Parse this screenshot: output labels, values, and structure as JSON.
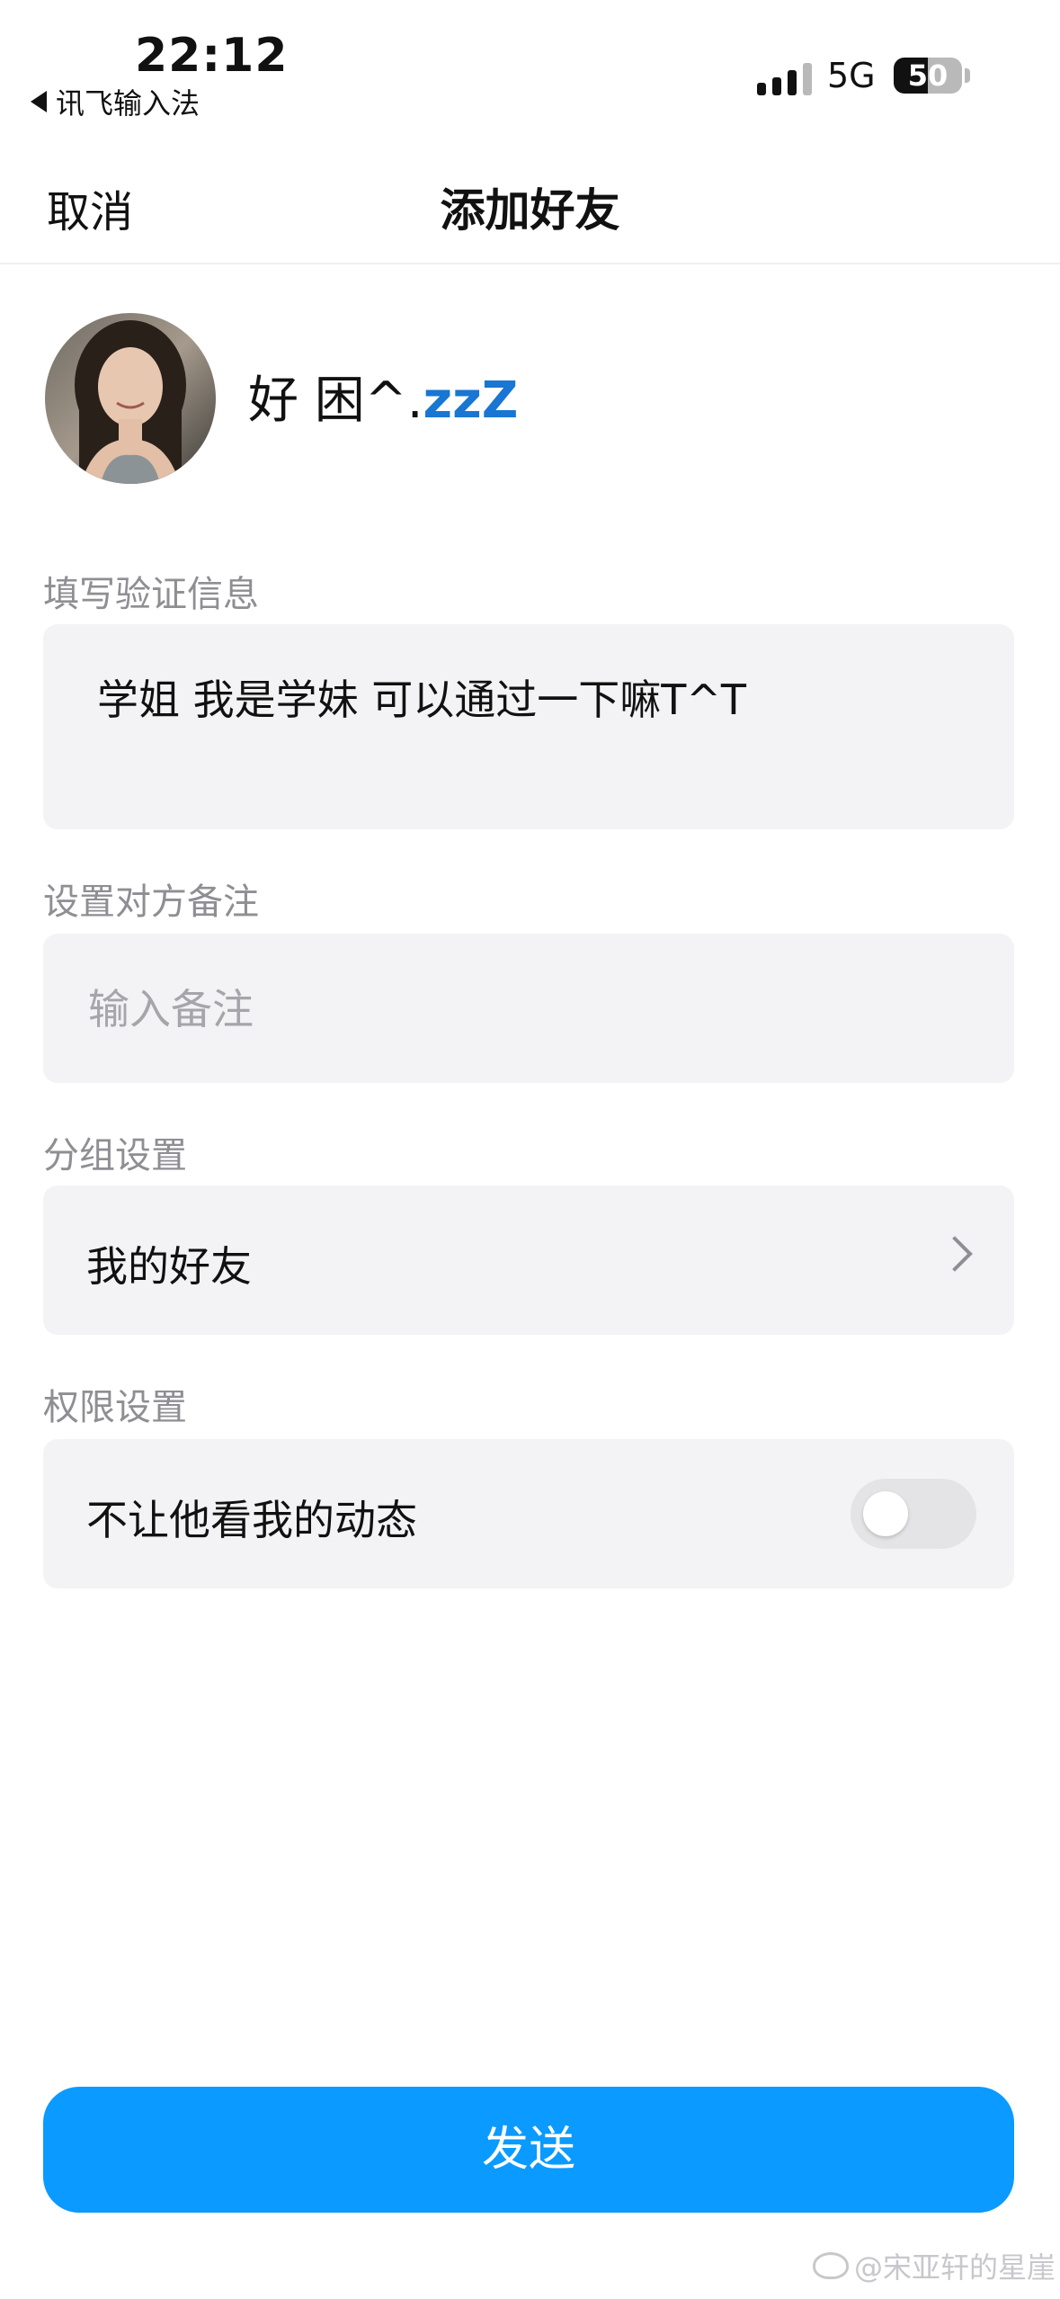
{
  "status_bar": {
    "time": "22:12",
    "back_app": "讯飞输入法",
    "network": "5G",
    "battery": "50",
    "battery_level": 0.5
  },
  "nav": {
    "cancel": "取消",
    "title": "添加好友"
  },
  "profile": {
    "nickname_prefix": "好 困^.",
    "nickname_zz": "zzZ"
  },
  "verify": {
    "label": "填写验证信息",
    "message": "学姐 我是学妹 可以通过一下嘛T^T"
  },
  "remark": {
    "label": "设置对方备注",
    "placeholder": "输入备注",
    "value": ""
  },
  "group": {
    "label": "分组设置",
    "value": "我的好友"
  },
  "permission": {
    "label": "权限设置",
    "option": "不让他看我的动态",
    "enabled": false
  },
  "send_label": "发送",
  "watermark": "@宋亚轩的星崖",
  "colors": {
    "accent": "#0b9aff",
    "card_bg": "#f3f3f5",
    "label_gray": "#8e8e93",
    "zz_blue": "#1976d2"
  }
}
